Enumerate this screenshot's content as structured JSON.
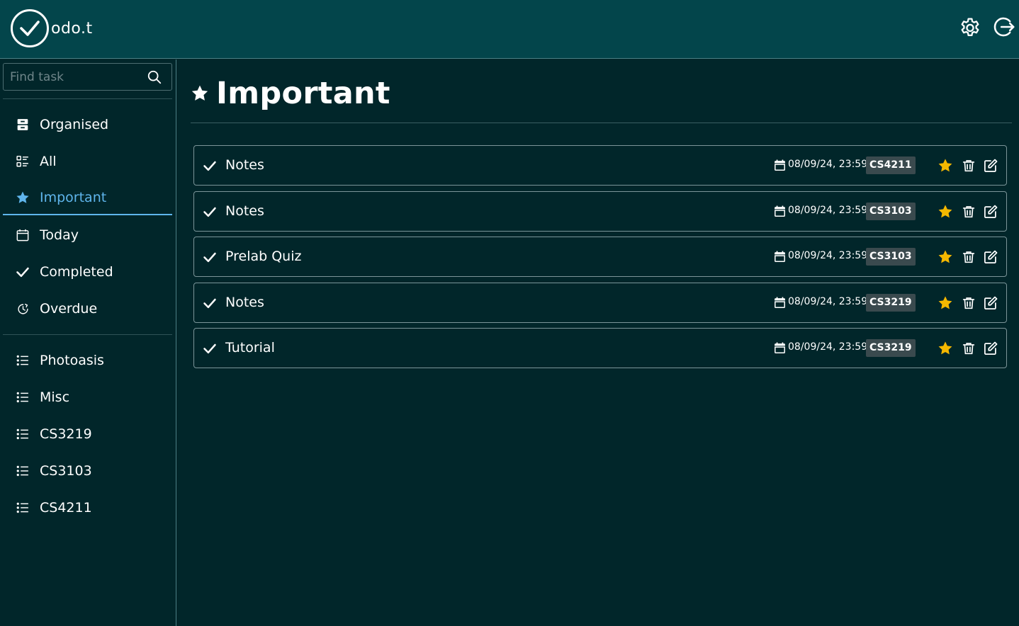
{
  "header": {
    "logo_text": "odo.t",
    "settings_icon": "gear-icon",
    "logout_icon": "logout-icon"
  },
  "search": {
    "placeholder": "Find task",
    "value": ""
  },
  "sidebar": {
    "nav": [
      {
        "label": "Organised",
        "icon": "archive-icon"
      },
      {
        "label": "All",
        "icon": "list-grid-icon"
      },
      {
        "label": "Important",
        "icon": "star-icon",
        "active": true
      },
      {
        "label": "Today",
        "icon": "calendar-icon"
      },
      {
        "label": "Completed",
        "icon": "check-icon"
      },
      {
        "label": "Overdue",
        "icon": "clock-icon"
      }
    ],
    "lists": [
      {
        "label": "Photoasis",
        "icon": "list-icon"
      },
      {
        "label": "Misc",
        "icon": "list-icon"
      },
      {
        "label": "CS3219",
        "icon": "list-icon"
      },
      {
        "label": "CS3103",
        "icon": "list-icon"
      },
      {
        "label": "CS4211",
        "icon": "list-icon"
      }
    ]
  },
  "main": {
    "title": "Important",
    "tasks": [
      {
        "title": "Notes",
        "due": "08/09/24, 23:59",
        "tag": "CS4211",
        "starred": true
      },
      {
        "title": "Notes",
        "due": "08/09/24, 23:59",
        "tag": "CS3103",
        "starred": true
      },
      {
        "title": "Prelab Quiz",
        "due": "08/09/24, 23:59",
        "tag": "CS3103",
        "starred": true
      },
      {
        "title": "Notes",
        "due": "08/09/24, 23:59",
        "tag": "CS3219",
        "starred": true
      },
      {
        "title": "Tutorial",
        "due": "08/09/24, 23:59",
        "tag": "CS3219",
        "starred": true
      }
    ]
  },
  "colors": {
    "header_bg": "#03454b",
    "page_bg": "#01262a",
    "accent": "#5fb5ec",
    "star": "#f5b800"
  }
}
